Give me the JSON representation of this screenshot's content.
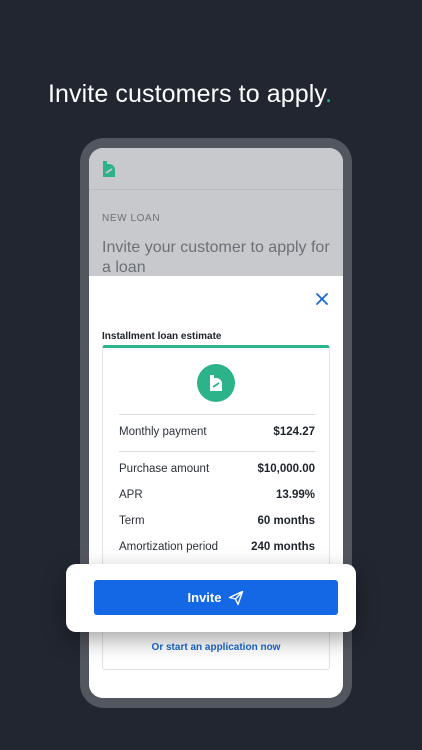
{
  "headline": {
    "text": "Invite customers to apply",
    "dot": "."
  },
  "screen": {
    "section_label": "NEW LOAN",
    "heading": "Invite your customer to apply for a loan"
  },
  "estimate": {
    "title": "Installment loan estimate",
    "monthly": {
      "label": "Monthly payment",
      "value": "$124.27"
    },
    "rows": [
      {
        "label": "Purchase amount",
        "value": "$10,000.00"
      },
      {
        "label": "APR",
        "value": "13.99%"
      },
      {
        "label": "Term",
        "value": "60 months"
      },
      {
        "label": "Amortization period",
        "value": "240 months"
      }
    ],
    "alt_link": "Or start an application now"
  },
  "invite": {
    "label": "Invite"
  },
  "icons": {
    "brand": "brand-logo-icon",
    "close": "close-icon",
    "send": "send-icon"
  },
  "colors": {
    "background": "#212630",
    "accent": "#2db38a",
    "primary_button": "#1467e5",
    "link": "#1967d2"
  }
}
